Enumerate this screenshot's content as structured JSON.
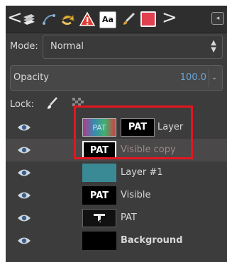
{
  "tabs": {
    "prev_arrow": "<",
    "next_arrow": ">",
    "menu_glyph": "◂",
    "icons": [
      "layers-icon",
      "paths-icon",
      "undo-history-icon",
      "warning-icon",
      "fonts-icon",
      "brush-icon",
      "pattern-icon"
    ],
    "aa_label": "Aa"
  },
  "mode": {
    "label": "Mode:",
    "value": "Normal"
  },
  "opacity": {
    "label": "Opacity",
    "value": "100.0"
  },
  "lock": {
    "label": "Lock:"
  },
  "layers": [
    {
      "name": "Layer",
      "thumb": "PAT",
      "mask": "PAT",
      "selected": false
    },
    {
      "name": "Visible copy",
      "thumb": "PAT",
      "selected": true
    },
    {
      "name": "Layer #1",
      "thumb": "",
      "color": "#3a8a96"
    },
    {
      "name": "Visible",
      "thumb": "PAT"
    },
    {
      "name": "PAT",
      "thumb": ""
    },
    {
      "name": "Background",
      "thumb": ""
    }
  ],
  "colors": {
    "panel": "#3c3c3c",
    "highlight": "#e3161f",
    "teal": "#3a8a96",
    "opacity_value": "#6aa4d8"
  }
}
